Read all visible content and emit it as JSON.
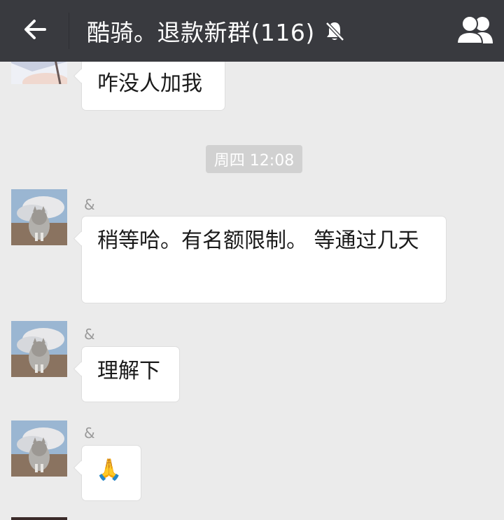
{
  "header": {
    "title": "酷骑。退款新群(116)",
    "back_icon": "back-arrow-icon",
    "mute_icon": "mute-bell-icon",
    "members_icon": "group-members-icon",
    "bg_color": "#393a3f"
  },
  "chat": {
    "timestamp": "周四 12:08",
    "messages": [
      {
        "sender": "",
        "text": "咋没人加我"
      },
      {
        "sender": "&",
        "text": "稍等哈。有名额限制。 等通过几天"
      },
      {
        "sender": "&",
        "text": "理解下"
      },
      {
        "sender": "&",
        "text": "🙏"
      }
    ]
  }
}
